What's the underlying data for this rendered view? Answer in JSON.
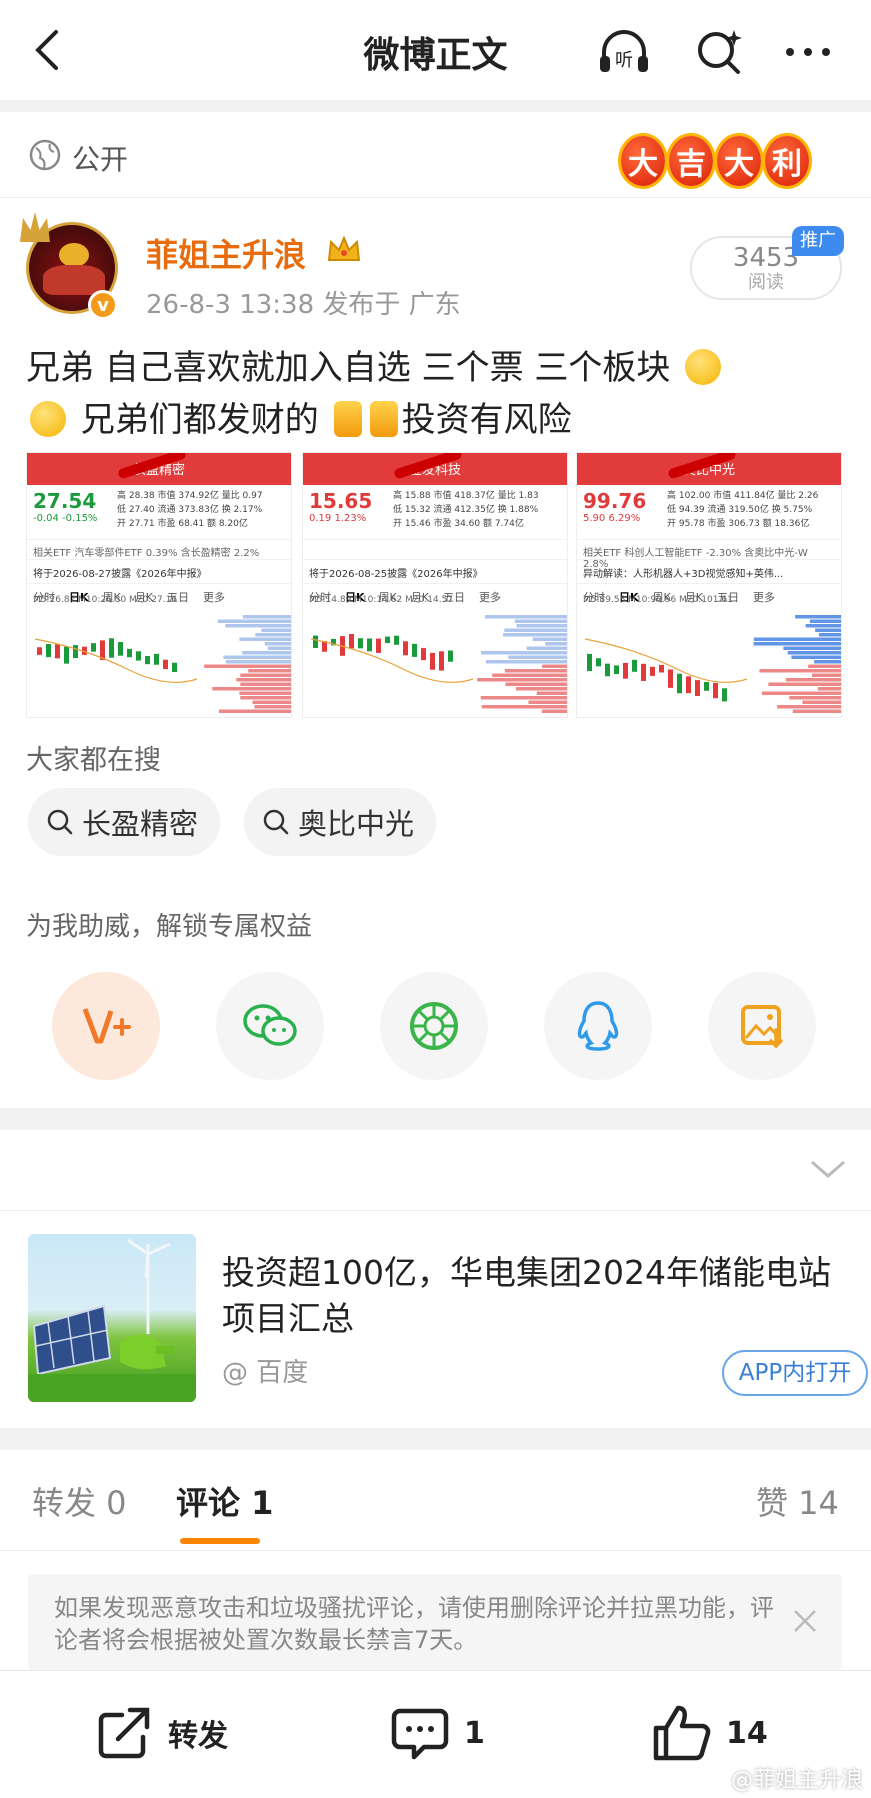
{
  "nav": {
    "title": "微博正文",
    "listen_label": "听"
  },
  "visibility": {
    "label": "公开",
    "luck_badge": [
      "大",
      "吉",
      "大",
      "利"
    ]
  },
  "author": {
    "name": "菲姐主升浪",
    "meta": "26-8-3 13:38  发布于 广东",
    "verified_badge": "v",
    "read_count": "3453",
    "read_label": "阅读",
    "promo_tag": "推广"
  },
  "post": {
    "text_1": "兄弟  自己喜欢就加入自选 三个票 三个板块",
    "text_2": "兄弟们都发财的",
    "text_3": "投资有风险"
  },
  "screenshots": [
    {
      "title": "长盈精密",
      "price": "27.54",
      "change": "-0.04  -0.15%",
      "quote_rows": [
        "高 28.38 市值 374.92亿 量比 0.97",
        "低 27.40 流通 373.83亿 换 2.17%",
        "开 27.71 市盈 68.41 额 8.20亿"
      ],
      "etf_row": "相关ETF    汽车零部件ETF 0.39%  含长盈精密 2.2%",
      "news_row": "将于2026-08-27披露《2026年中报》",
      "tabs": [
        "分时",
        "日K",
        "周K",
        "月K",
        "五日",
        "更多"
      ],
      "ma_row": "M5:26.87  M10:26.30  M20:27.16",
      "price_color": "#1a9a3a"
    },
    {
      "title": "金发科技",
      "price": "15.65",
      "change": "0.19  1.23%",
      "quote_rows": [
        "高 15.88 市值 418.37亿 量比 1.83",
        "低 15.32 流通 412.35亿 换 1.88%",
        "开 15.46 市盈 34.60 额 7.74亿"
      ],
      "etf_row": "",
      "news_row": "将于2026-08-25披露《2026年中报》",
      "tabs": [
        "分时",
        "日K",
        "周K",
        "月K",
        "五日",
        "更多"
      ],
      "ma_row": "M5:14.89  M10:14.62  M20:14.57",
      "price_color": "#e03a3a"
    },
    {
      "title": "奥比中光",
      "price": "99.76",
      "change": "5.90  6.29%",
      "quote_rows": [
        "高 102.00 市值 411.84亿 量比 2.26",
        "低 94.39 流通 319.50亿 换 5.75%",
        "开 95.78 市盈 306.73 额 18.36亿"
      ],
      "etf_row": "相关ETF   科创人工智能ETF -2.30%  含奥比中光-W 2.8%",
      "news_row": "异动解读：人形机器人+3D视觉感知+英伟...",
      "tabs": [
        "分时",
        "日K",
        "周K",
        "月K",
        "五日",
        "更多"
      ],
      "ma_row": "M5:89.58  M10:90.96  M20:101.61",
      "price_color": "#e03a3a"
    }
  ],
  "search": {
    "label": "大家都在搜",
    "pills": [
      "长盈精密",
      "奥比中光"
    ]
  },
  "share": {
    "label": "为我助威，解锁专属权益",
    "buttons": [
      "v-plus-icon",
      "wechat-icon",
      "moments-icon",
      "qq-icon",
      "save-image-icon"
    ]
  },
  "related": {
    "title": "投资超100亿，华电集团2024年储能电站项目汇总",
    "source": "@ 百度",
    "open_label": "APP内打开"
  },
  "tabs": {
    "repost": "转发 0",
    "comment": "评论 1",
    "like": "赞 14"
  },
  "notice": {
    "text": "如果发现恶意攻击和垃圾骚扰评论，请使用删除评论并拉黑功能，评论者将会根据被处置次数最长禁言7天。"
  },
  "bottom": {
    "repost_label": "转发",
    "comment_count": "1",
    "like_count": "14",
    "watermark": "@菲姐主升浪"
  },
  "colors": {
    "accent": "#ff8200",
    "author": "#e86b0c",
    "link": "#3a7fd5"
  }
}
